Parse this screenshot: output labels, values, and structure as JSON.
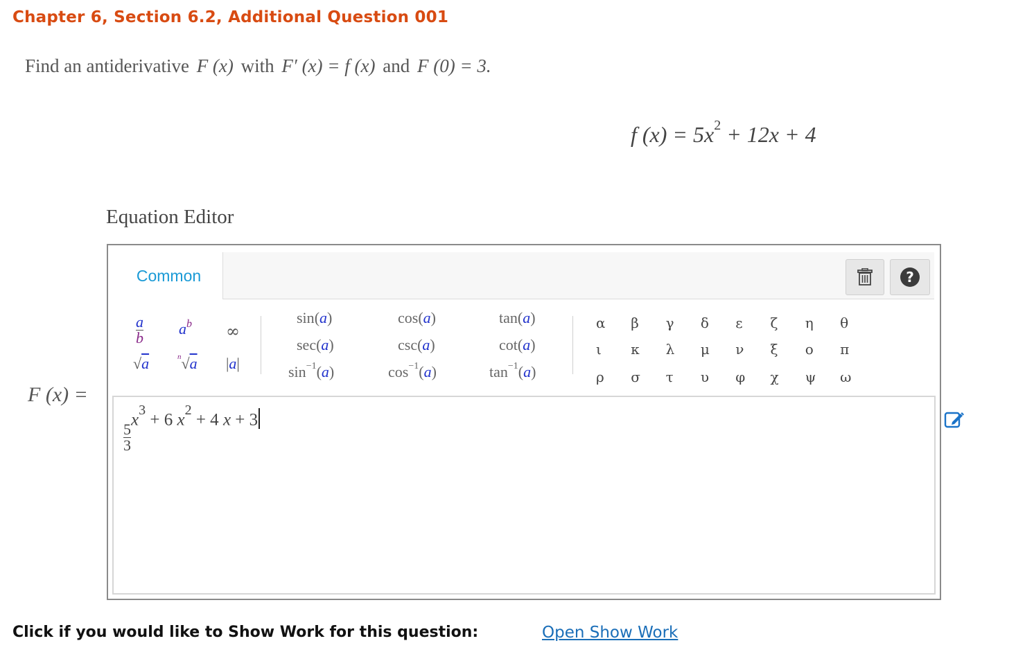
{
  "header": {
    "title": "Chapter 6, Section 6.2, Additional Question 001"
  },
  "question": {
    "t1": "Find an antiderivative",
    "f1": "F (x)",
    "t2": "with",
    "f2": "F′ (x) = f (x)",
    "t3": "and",
    "f3": "F (0) = 3."
  },
  "given": {
    "lhs": "f (x) = 5x",
    "exp": "2",
    "rhs": " + 12x + 4"
  },
  "editor": {
    "label": "Equation Editor",
    "tab_common": "Common",
    "palette": {
      "frac_num": "a",
      "frac_den": "b",
      "pow_base": "a",
      "pow_exp": "b",
      "infinity": "∞",
      "sqrt_sym": "√",
      "sqrt_var": "a",
      "nthroot_idx": "n",
      "nthroot_sym": "√",
      "nthroot_var": "a",
      "abs_l": "|",
      "abs_var": "a",
      "abs_r": "|",
      "trig": [
        {
          "fn": "sin",
          "arg": "a"
        },
        {
          "fn": "cos",
          "arg": "a"
        },
        {
          "fn": "tan",
          "arg": "a"
        },
        {
          "fn": "sec",
          "arg": "a"
        },
        {
          "fn": "csc",
          "arg": "a"
        },
        {
          "fn": "cot",
          "arg": "a"
        }
      ],
      "inv_trig": [
        {
          "fn": "sin",
          "sup": "−1",
          "arg": "a"
        },
        {
          "fn": "cos",
          "sup": "−1",
          "arg": "a"
        },
        {
          "fn": "tan",
          "sup": "−1",
          "arg": "a"
        }
      ],
      "greek": [
        "α",
        "β",
        "γ",
        "δ",
        "ε",
        "ζ",
        "η",
        "θ",
        "ι",
        "κ",
        "λ",
        "μ",
        "ν",
        "ξ",
        "ο",
        "π",
        "ρ",
        "σ",
        "τ",
        "υ",
        "φ",
        "χ",
        "ψ",
        "ω"
      ]
    },
    "answer": {
      "num": "5",
      "den": "3",
      "e1": "3",
      "var1": "x",
      "term2": "+ 6",
      "var2": "x",
      "e2": "2",
      "term3": "+ 4",
      "var3": "x",
      "term4": "+ 3"
    }
  },
  "answer_label": "F (x) =",
  "footer": {
    "prompt": "Click if you would like to Show Work for this question:",
    "link": "Open Show Work"
  },
  "colors": {
    "title": "#d84b12",
    "link": "#1a6eb8",
    "tab": "#1a9ad6"
  },
  "icons": [
    "trash-icon",
    "help-icon",
    "edit-icon"
  ]
}
